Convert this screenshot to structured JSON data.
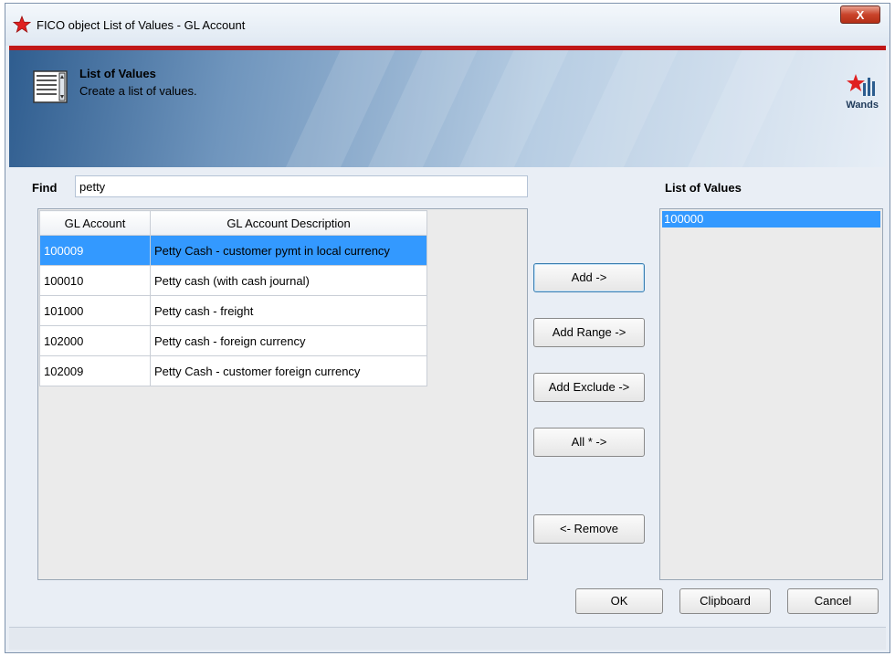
{
  "window": {
    "title": "FICO object List of Values - GL Account",
    "close_label": "X"
  },
  "header": {
    "title": "List of Values",
    "subtitle": "Create a list of values.",
    "brand": "Wands"
  },
  "find": {
    "label": "Find",
    "value": "petty"
  },
  "grid": {
    "columns": [
      "GL Account",
      "GL Account Description"
    ],
    "rows": [
      {
        "account": "100009",
        "description": "Petty Cash - customer pymt in local currency",
        "selected": true
      },
      {
        "account": "100010",
        "description": "Petty cash (with cash journal)"
      },
      {
        "account": "101000",
        "description": "Petty cash - freight"
      },
      {
        "account": "102000",
        "description": "Petty cash - foreign currency"
      },
      {
        "account": "102009",
        "description": "Petty Cash - customer foreign currency"
      }
    ]
  },
  "actions": {
    "add": "Add ->",
    "add_range": "Add Range ->",
    "add_exclude": "Add Exclude ->",
    "all": "All * ->",
    "remove": "<- Remove"
  },
  "list_of_values": {
    "label": "List of Values",
    "items": [
      "100000"
    ]
  },
  "footer": {
    "ok": "OK",
    "clipboard": "Clipboard",
    "cancel": "Cancel"
  },
  "colors": {
    "selection": "#3399ff",
    "header_accent": "#c01818"
  }
}
